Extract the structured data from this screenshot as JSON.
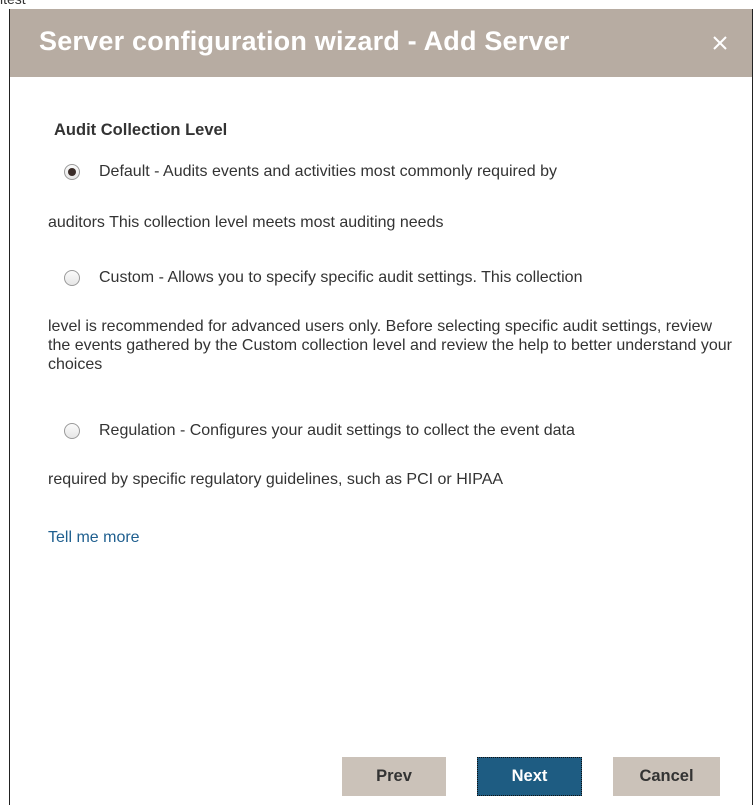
{
  "top_fragment": "itest",
  "dialog": {
    "title": "Server configuration wizard - Add Server",
    "close_glyph": "×"
  },
  "section": {
    "heading": "Audit Collection Level"
  },
  "options": [
    {
      "label": "Default - Audits events and activities most commonly required by",
      "description": "auditors This collection level meets most auditing needs",
      "selected": true
    },
    {
      "label": "Custom - Allows you to specify specific audit settings. This collection",
      "description": "level is recommended for advanced users only. Before selecting specific audit settings, review the events gathered by the Custom collection level and review the help to better understand your choices",
      "selected": false
    },
    {
      "label": "Regulation - Configures your audit settings to collect the event data",
      "description": "required by specific regulatory guidelines, such as PCI or HIPAA",
      "selected": false
    }
  ],
  "links": {
    "tell_me_more": "Tell me more"
  },
  "buttons": {
    "prev": "Prev",
    "next": "Next",
    "cancel": "Cancel"
  },
  "colors": {
    "title_bar": "#b7aca2",
    "primary_button": "#1e5c82",
    "secondary_button": "#cbc2b9",
    "link": "#1f5f8f"
  }
}
